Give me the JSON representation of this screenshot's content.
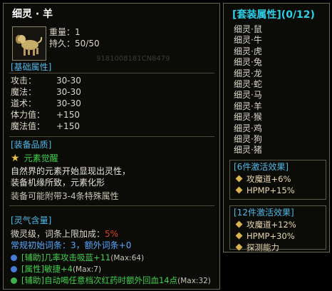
{
  "item": {
    "name": "细灵 · 羊",
    "weight_label": "重量：",
    "weight_value": "1",
    "durability_label": "持久：",
    "durability_value": "50/50",
    "watermark": "9181008181CN8479"
  },
  "base": {
    "header": "[基础属性]",
    "stats": [
      {
        "label": "攻击：",
        "value": "30-30"
      },
      {
        "label": "魔法：",
        "value": "30-30"
      },
      {
        "label": "道术：",
        "value": "30-30"
      },
      {
        "label": "体力值：",
        "value": "+150"
      },
      {
        "label": "魔法值：",
        "value": "+150"
      }
    ]
  },
  "quality": {
    "header": "[装备品质]",
    "name": "元素觉醒",
    "desc1": "自然界的元素开始显现出灵性，",
    "desc2": "装备机缘所致，元素化形",
    "note": "装备可能附带3-4条特殊属性"
  },
  "spirit": {
    "header": "[灵气含量]",
    "line1_text": "微灵级，词条上限加成：",
    "line1_value": "5%",
    "line2": "常规初始词条：3，额外词条+0",
    "affixes": [
      {
        "text": "[辅助]几率攻击吸蓝+11",
        "max": "(Max:64)",
        "color": "#4a7ad8"
      },
      {
        "text": "[属性]敏捷+4",
        "max": "(Max:7)",
        "color": "#4a7ad8"
      },
      {
        "text": "[辅助]自动喝任意档次红药时额外回血14点",
        "max": "(Max:32)",
        "color": "#3fb04a"
      }
    ]
  },
  "set": {
    "header": "[套装属性](0/12)",
    "members": [
      "细灵·鼠",
      "细灵·牛",
      "细灵·虎",
      "细灵·兔",
      "细灵·龙",
      "细灵·蛇",
      "细灵·马",
      "细灵·羊",
      "细灵·猴",
      "细灵·鸡",
      "细灵·狗",
      "细灵·猪"
    ],
    "bonus6_header": "[6件激活效果]",
    "bonus6": [
      "攻魔道+6%",
      "HPMP+15%"
    ],
    "bonus12_header": "[12件激活效果]",
    "bonus12": [
      "攻魔道+12%",
      "HPMP+30%",
      "探测能力"
    ]
  },
  "colors": {
    "section": "#4fb9e8",
    "green": "#3fd24a",
    "red": "#e0402a",
    "gold": "#d8b44a"
  }
}
